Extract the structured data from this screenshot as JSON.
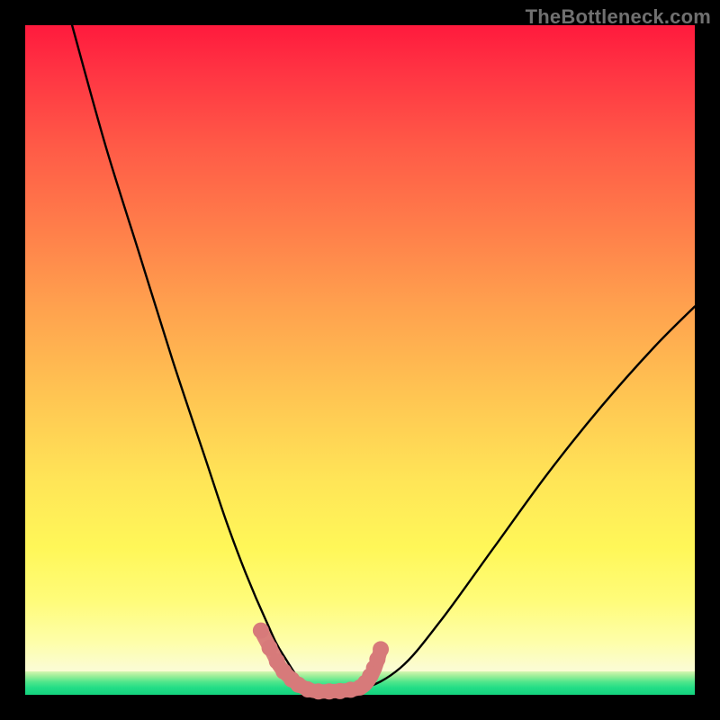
{
  "watermark": "TheBottleneck.com",
  "chart_data": {
    "type": "line",
    "title": "",
    "xlabel": "",
    "ylabel": "",
    "xlim": [
      0,
      100
    ],
    "ylim": [
      0,
      100
    ],
    "grid": false,
    "series": [
      {
        "name": "bottleneck-curve",
        "color": "#000000",
        "x": [
          7,
          12,
          17,
          22,
          27,
          30,
          33,
          36,
          38.5,
          43,
          50,
          56,
          62,
          70,
          78,
          86,
          94,
          100
        ],
        "values": [
          100,
          82,
          66,
          50,
          35,
          26,
          18,
          11,
          6,
          0.5,
          0.8,
          4,
          11,
          22,
          33,
          43,
          52,
          58
        ]
      },
      {
        "name": "highlight-trough",
        "color": "#d77a7a",
        "x": [
          35.5,
          37,
          38,
          39.5,
          41,
          43,
          45,
          47,
          49,
          50.5,
          51.5,
          52.3,
          53
        ],
        "values": [
          9,
          6.2,
          4.3,
          2.6,
          1.4,
          0.6,
          0.5,
          0.6,
          0.8,
          1.3,
          2.5,
          4.2,
          6.4
        ]
      }
    ],
    "marker_points": {
      "name": "highlight-dots",
      "color": "#d77a7a",
      "x": [
        35.2,
        36.5,
        37.6,
        38.6,
        39.8,
        40.8,
        42.2,
        43.8,
        45.4,
        47,
        48.6,
        50,
        50.8,
        51.5,
        52.1,
        52.6,
        53.1
      ],
      "values": [
        9.6,
        7,
        5,
        3.5,
        2.3,
        1.5,
        0.8,
        0.5,
        0.5,
        0.55,
        0.75,
        1.1,
        1.8,
        2.8,
        4,
        5.3,
        6.8
      ]
    },
    "gradient_stops": [
      {
        "pos": 0,
        "color": "#ff1a3d"
      },
      {
        "pos": 30,
        "color": "#ff7d4a"
      },
      {
        "pos": 68,
        "color": "#ffe557"
      },
      {
        "pos": 96,
        "color": "#fbfcd2"
      },
      {
        "pos": 100,
        "color": "#14d37e"
      }
    ]
  }
}
